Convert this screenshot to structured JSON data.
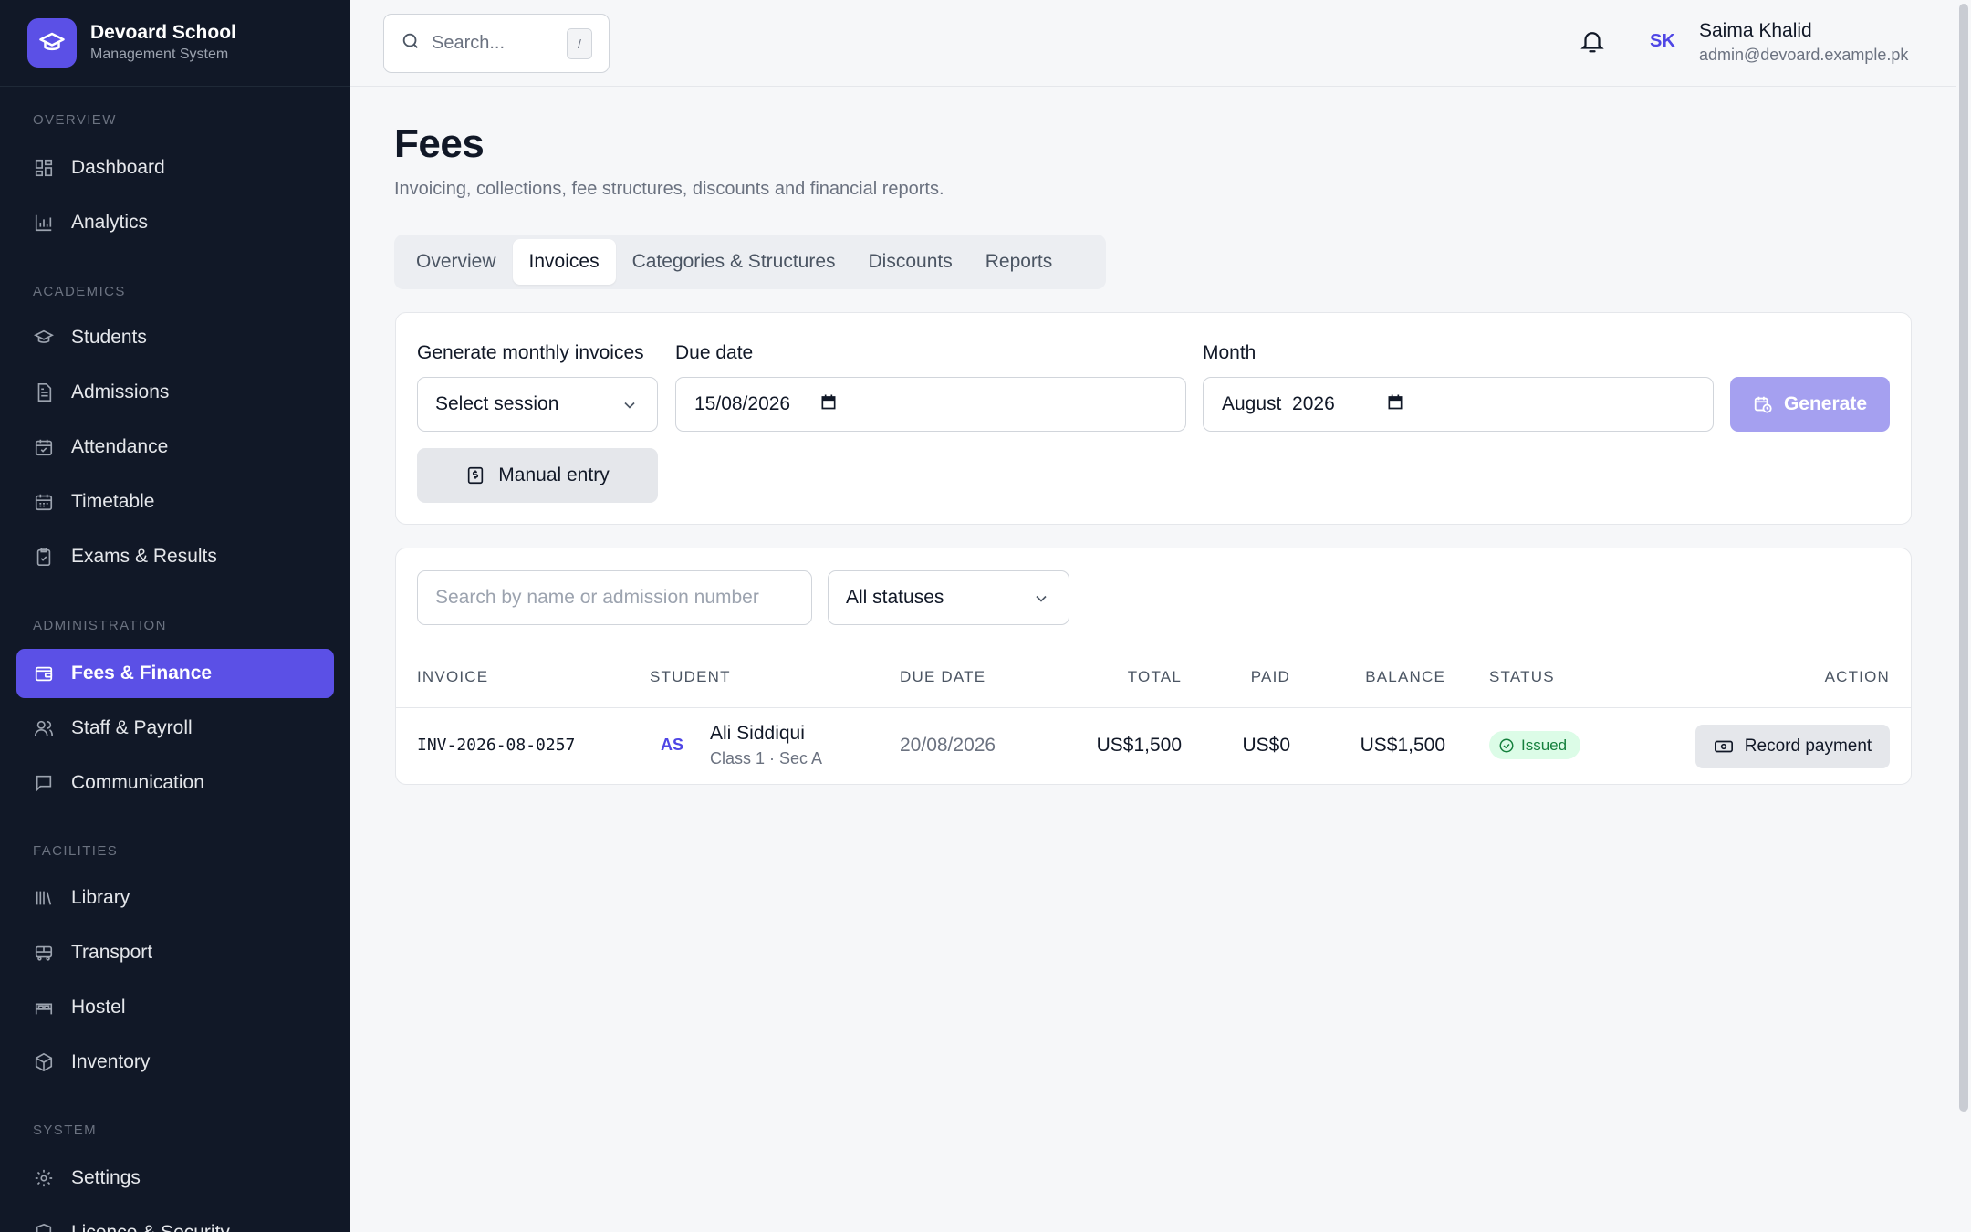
{
  "app": {
    "name": "Devoard School",
    "subtitle": "Management System"
  },
  "sidebar": {
    "sections": {
      "overview": "OVERVIEW",
      "academics": "ACADEMICS",
      "administration": "ADMINISTRATION",
      "facilities": "FACILITIES",
      "system": "SYSTEM"
    },
    "items": [
      {
        "label": "Dashboard",
        "icon": "grid-icon"
      },
      {
        "label": "Analytics",
        "icon": "bar-chart-icon"
      },
      {
        "label": "Students",
        "icon": "graduation-cap-icon"
      },
      {
        "label": "Admissions",
        "icon": "document-icon"
      },
      {
        "label": "Attendance",
        "icon": "calendar-check-icon"
      },
      {
        "label": "Timetable",
        "icon": "calendar-icon"
      },
      {
        "label": "Exams & Results",
        "icon": "clipboard-check-icon"
      },
      {
        "label": "Fees & Finance",
        "icon": "wallet-icon",
        "active": true
      },
      {
        "label": "Staff & Payroll",
        "icon": "users-icon"
      },
      {
        "label": "Communication",
        "icon": "message-icon"
      },
      {
        "label": "Library",
        "icon": "library-icon"
      },
      {
        "label": "Transport",
        "icon": "bus-icon"
      },
      {
        "label": "Hostel",
        "icon": "bed-icon"
      },
      {
        "label": "Inventory",
        "icon": "package-icon"
      },
      {
        "label": "Settings",
        "icon": "gear-icon"
      },
      {
        "label": "Licence & Security",
        "icon": "shield-icon"
      }
    ]
  },
  "topbar": {
    "search_placeholder": "Search...",
    "search_shortcut": "/",
    "user": {
      "initials": "SK",
      "name": "Saima Khalid",
      "email": "admin@devoard.example.pk"
    }
  },
  "page": {
    "title": "Fees",
    "subtitle": "Invoicing, collections, fee structures, discounts and financial reports."
  },
  "tabs": [
    {
      "label": "Overview"
    },
    {
      "label": "Invoices",
      "active": true
    },
    {
      "label": "Categories & Structures"
    },
    {
      "label": "Discounts"
    },
    {
      "label": "Reports"
    }
  ],
  "generate_form": {
    "session_label": "Generate monthly invoices",
    "session_value": "Select session",
    "due_date_label": "Due date",
    "due_date_value": "15/08/2026",
    "month_label": "Month",
    "month_value": "August  2026",
    "generate_button": "Generate",
    "manual_entry_button": "Manual entry"
  },
  "filters": {
    "search_placeholder": "Search by name or admission number",
    "status_value": "All statuses"
  },
  "table": {
    "headers": {
      "invoice": "INVOICE",
      "student": "STUDENT",
      "due_date": "DUE DATE",
      "total": "TOTAL",
      "paid": "PAID",
      "balance": "BALANCE",
      "status": "STATUS",
      "action": "ACTION"
    },
    "rows": [
      {
        "invoice": "INV-2026-08-0257",
        "student_initials": "AS",
        "student_name": "Ali Siddiqui",
        "student_class": "Class 1 · Sec A",
        "due_date": "20/08/2026",
        "total": "US$1,500",
        "paid": "US$0",
        "balance": "US$1,500",
        "status": "Issued",
        "action": "Record payment"
      }
    ]
  },
  "colors": {
    "sidebar_bg": "#111827",
    "accent": "#5b50e6",
    "page_bg": "#f6f7f9",
    "status_issued_bg": "#dcfce7",
    "status_issued_text": "#15803d"
  }
}
